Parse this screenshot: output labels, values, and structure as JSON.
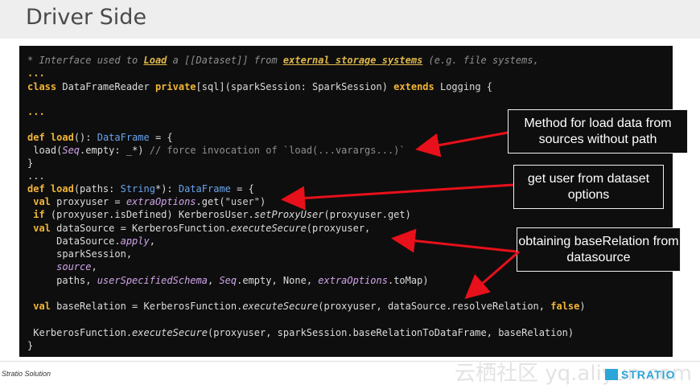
{
  "header": {
    "title": "Driver Side"
  },
  "code": {
    "l1_a": "* Interface used to ",
    "l1_load": "Load",
    "l1_b": " a [[Dataset]] from ",
    "l1_ext": "external storage systems",
    "l1_c": " (e.g. file systems,",
    "l2": "...",
    "l3_class": "class",
    "l3_name": " DataFrameReader ",
    "l3_private": "private",
    "l3_mid": "[sql](sparkSession: SparkSession) ",
    "l3_extends": "extends",
    "l3_end": " Logging {",
    "l4": "...",
    "l5_def": "def",
    "l5_load": " load",
    "l5_mid": "(): ",
    "l5_type": "DataFrame",
    "l5_end": " = {",
    "l6_a": " load(",
    "l6_seq": "Seq",
    "l6_b": ".empty: _*) ",
    "l6_cm": "// force invocation of `load(...varargs...)`",
    "l7": "}",
    "l8": "...",
    "l9_def": "def",
    "l9_load": " load",
    "l9_a": "(paths: ",
    "l9_string": "String",
    "l9_b": "*): ",
    "l9_type": "DataFrame",
    "l9_end": " = {",
    "l10_val": " val",
    "l10_a": " proxyuser = ",
    "l10_extra": "extraOptions",
    "l10_b": ".get(",
    "l10_str": "\"user\"",
    "l10_end": ")",
    "l11_if": " if",
    "l11_a": " (proxyuser.isDefined) KerberosUser.",
    "l11_method": "setProxyUser",
    "l11_end": "(proxyuser.get)",
    "l12_val": " val",
    "l12_a": " dataSource = KerberosFunction.",
    "l12_method": "executeSecure",
    "l12_end": "(proxyuser,",
    "l13_a": "     DataSource.",
    "l13_apply": "apply",
    "l13_end": ",",
    "l14": "     sparkSession,",
    "l15_src": "source",
    "l15_end": ",",
    "l16_a": "     paths, ",
    "l16_schema": "userSpecifiedSchema",
    "l16_b": ", ",
    "l16_seq": "Seq",
    "l16_c": ".empty, None, ",
    "l16_extra": "extraOptions",
    "l16_end": ".toMap)",
    "l17_val": " val",
    "l17_a": " baseRelation = KerberosFunction.",
    "l17_method": "executeSecure",
    "l17_b": "(proxyuser, dataSource.resolveRelation, ",
    "l17_false": "false",
    "l17_end": ")",
    "l18_a": " KerberosFunction.",
    "l18_method": "executeSecure",
    "l18_end": "(proxyuser, sparkSession.baseRelationToDataFrame, baseRelation)",
    "l19": "}"
  },
  "callouts": {
    "c1": "Method for load data from sources without path",
    "c2": "get user from dataset options",
    "c3": "obtaining baseRelation from datasource"
  },
  "footer": {
    "left": "Stratio Solution",
    "watermark": "云栖社区 yq.aliyun.com",
    "logo": "STRATIO"
  },
  "colors": {
    "keyword": "#f3b536",
    "arrow": "#e8101a",
    "logo": "#2aa6d8"
  }
}
